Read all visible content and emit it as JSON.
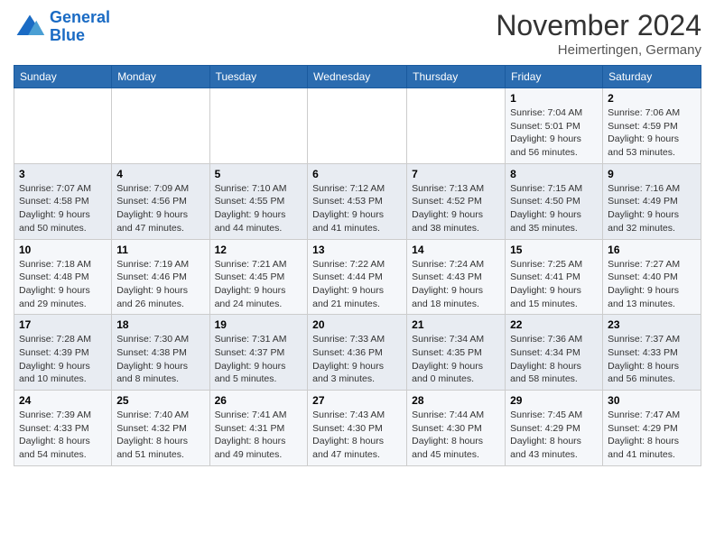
{
  "header": {
    "logo_line1": "General",
    "logo_line2": "Blue",
    "month": "November 2024",
    "location": "Heimertingen, Germany"
  },
  "weekdays": [
    "Sunday",
    "Monday",
    "Tuesday",
    "Wednesday",
    "Thursday",
    "Friday",
    "Saturday"
  ],
  "weeks": [
    [
      {
        "day": "",
        "info": ""
      },
      {
        "day": "",
        "info": ""
      },
      {
        "day": "",
        "info": ""
      },
      {
        "day": "",
        "info": ""
      },
      {
        "day": "",
        "info": ""
      },
      {
        "day": "1",
        "info": "Sunrise: 7:04 AM\nSunset: 5:01 PM\nDaylight: 9 hours and 56 minutes."
      },
      {
        "day": "2",
        "info": "Sunrise: 7:06 AM\nSunset: 4:59 PM\nDaylight: 9 hours and 53 minutes."
      }
    ],
    [
      {
        "day": "3",
        "info": "Sunrise: 7:07 AM\nSunset: 4:58 PM\nDaylight: 9 hours and 50 minutes."
      },
      {
        "day": "4",
        "info": "Sunrise: 7:09 AM\nSunset: 4:56 PM\nDaylight: 9 hours and 47 minutes."
      },
      {
        "day": "5",
        "info": "Sunrise: 7:10 AM\nSunset: 4:55 PM\nDaylight: 9 hours and 44 minutes."
      },
      {
        "day": "6",
        "info": "Sunrise: 7:12 AM\nSunset: 4:53 PM\nDaylight: 9 hours and 41 minutes."
      },
      {
        "day": "7",
        "info": "Sunrise: 7:13 AM\nSunset: 4:52 PM\nDaylight: 9 hours and 38 minutes."
      },
      {
        "day": "8",
        "info": "Sunrise: 7:15 AM\nSunset: 4:50 PM\nDaylight: 9 hours and 35 minutes."
      },
      {
        "day": "9",
        "info": "Sunrise: 7:16 AM\nSunset: 4:49 PM\nDaylight: 9 hours and 32 minutes."
      }
    ],
    [
      {
        "day": "10",
        "info": "Sunrise: 7:18 AM\nSunset: 4:48 PM\nDaylight: 9 hours and 29 minutes."
      },
      {
        "day": "11",
        "info": "Sunrise: 7:19 AM\nSunset: 4:46 PM\nDaylight: 9 hours and 26 minutes."
      },
      {
        "day": "12",
        "info": "Sunrise: 7:21 AM\nSunset: 4:45 PM\nDaylight: 9 hours and 24 minutes."
      },
      {
        "day": "13",
        "info": "Sunrise: 7:22 AM\nSunset: 4:44 PM\nDaylight: 9 hours and 21 minutes."
      },
      {
        "day": "14",
        "info": "Sunrise: 7:24 AM\nSunset: 4:43 PM\nDaylight: 9 hours and 18 minutes."
      },
      {
        "day": "15",
        "info": "Sunrise: 7:25 AM\nSunset: 4:41 PM\nDaylight: 9 hours and 15 minutes."
      },
      {
        "day": "16",
        "info": "Sunrise: 7:27 AM\nSunset: 4:40 PM\nDaylight: 9 hours and 13 minutes."
      }
    ],
    [
      {
        "day": "17",
        "info": "Sunrise: 7:28 AM\nSunset: 4:39 PM\nDaylight: 9 hours and 10 minutes."
      },
      {
        "day": "18",
        "info": "Sunrise: 7:30 AM\nSunset: 4:38 PM\nDaylight: 9 hours and 8 minutes."
      },
      {
        "day": "19",
        "info": "Sunrise: 7:31 AM\nSunset: 4:37 PM\nDaylight: 9 hours and 5 minutes."
      },
      {
        "day": "20",
        "info": "Sunrise: 7:33 AM\nSunset: 4:36 PM\nDaylight: 9 hours and 3 minutes."
      },
      {
        "day": "21",
        "info": "Sunrise: 7:34 AM\nSunset: 4:35 PM\nDaylight: 9 hours and 0 minutes."
      },
      {
        "day": "22",
        "info": "Sunrise: 7:36 AM\nSunset: 4:34 PM\nDaylight: 8 hours and 58 minutes."
      },
      {
        "day": "23",
        "info": "Sunrise: 7:37 AM\nSunset: 4:33 PM\nDaylight: 8 hours and 56 minutes."
      }
    ],
    [
      {
        "day": "24",
        "info": "Sunrise: 7:39 AM\nSunset: 4:33 PM\nDaylight: 8 hours and 54 minutes."
      },
      {
        "day": "25",
        "info": "Sunrise: 7:40 AM\nSunset: 4:32 PM\nDaylight: 8 hours and 51 minutes."
      },
      {
        "day": "26",
        "info": "Sunrise: 7:41 AM\nSunset: 4:31 PM\nDaylight: 8 hours and 49 minutes."
      },
      {
        "day": "27",
        "info": "Sunrise: 7:43 AM\nSunset: 4:30 PM\nDaylight: 8 hours and 47 minutes."
      },
      {
        "day": "28",
        "info": "Sunrise: 7:44 AM\nSunset: 4:30 PM\nDaylight: 8 hours and 45 minutes."
      },
      {
        "day": "29",
        "info": "Sunrise: 7:45 AM\nSunset: 4:29 PM\nDaylight: 8 hours and 43 minutes."
      },
      {
        "day": "30",
        "info": "Sunrise: 7:47 AM\nSunset: 4:29 PM\nDaylight: 8 hours and 41 minutes."
      }
    ]
  ]
}
